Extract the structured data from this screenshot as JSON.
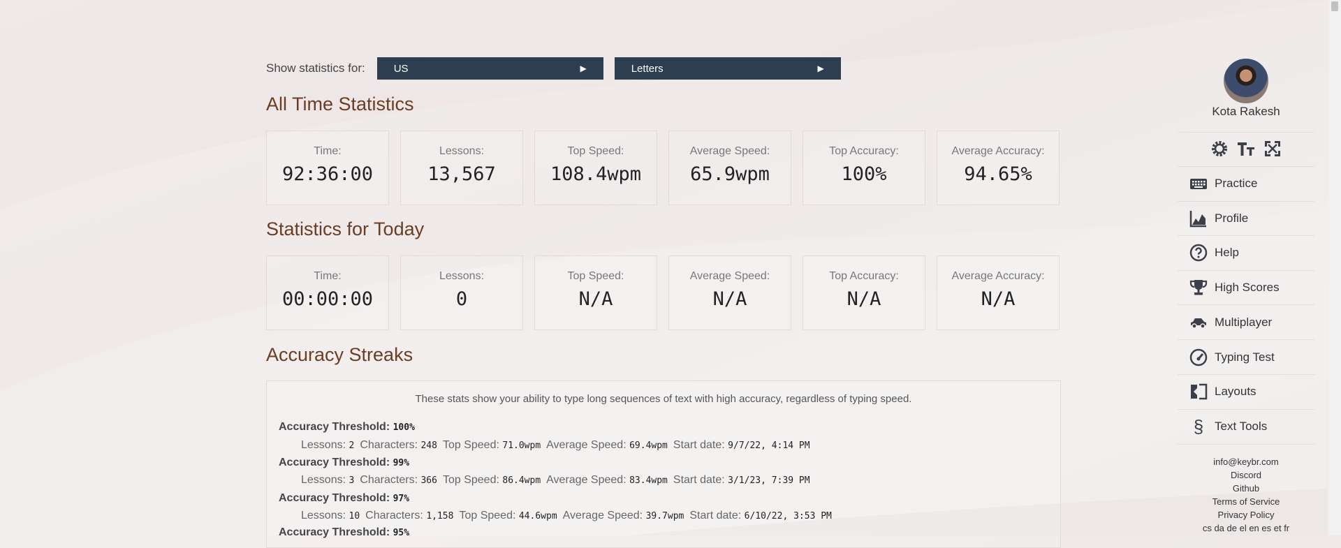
{
  "selector": {
    "label": "Show statistics for:",
    "layout_value": "US",
    "mode_value": "Letters"
  },
  "all_time": {
    "heading": "All Time Statistics",
    "cards": [
      {
        "label": "Time:",
        "value": "92:36:00"
      },
      {
        "label": "Lessons:",
        "value": "13,567"
      },
      {
        "label": "Top Speed:",
        "value": "108.4wpm"
      },
      {
        "label": "Average Speed:",
        "value": "65.9wpm"
      },
      {
        "label": "Top Accuracy:",
        "value": "100%"
      },
      {
        "label": "Average Accuracy:",
        "value": "94.65%"
      }
    ]
  },
  "today": {
    "heading": "Statistics for Today",
    "cards": [
      {
        "label": "Time:",
        "value": "00:00:00"
      },
      {
        "label": "Lessons:",
        "value": "0"
      },
      {
        "label": "Top Speed:",
        "value": "N/A"
      },
      {
        "label": "Average Speed:",
        "value": "N/A"
      },
      {
        "label": "Top Accuracy:",
        "value": "N/A"
      },
      {
        "label": "Average Accuracy:",
        "value": "N/A"
      }
    ]
  },
  "streaks": {
    "heading": "Accuracy Streaks",
    "intro": "These stats show your ability to type long sequences of text with high accuracy, regardless of typing speed.",
    "threshold_label": "Accuracy Threshold:",
    "labels": {
      "lessons": "Lessons:",
      "characters": "Characters:",
      "top_speed": "Top Speed:",
      "avg_speed": "Average Speed:",
      "start_date": "Start date:"
    },
    "rows": [
      {
        "threshold": "100%",
        "lessons": "2",
        "characters": "248",
        "top_speed": "71.0wpm",
        "avg_speed": "69.4wpm",
        "start_date": "9/7/22, 4:14 PM"
      },
      {
        "threshold": "99%",
        "lessons": "3",
        "characters": "366",
        "top_speed": "86.4wpm",
        "avg_speed": "83.4wpm",
        "start_date": "3/1/23, 7:39 PM"
      },
      {
        "threshold": "97%",
        "lessons": "10",
        "characters": "1,158",
        "top_speed": "44.6wpm",
        "avg_speed": "39.7wpm",
        "start_date": "6/10/22, 3:53 PM"
      },
      {
        "threshold": "95%"
      }
    ]
  },
  "sidebar": {
    "user_name": "Kota Rakesh",
    "nav": [
      {
        "label": "Practice",
        "icon": "keyboard-icon"
      },
      {
        "label": "Profile",
        "icon": "chart-icon"
      },
      {
        "label": "Help",
        "icon": "help-icon"
      },
      {
        "label": "High Scores",
        "icon": "trophy-icon"
      },
      {
        "label": "Multiplayer",
        "icon": "car-icon"
      },
      {
        "label": "Typing Test",
        "icon": "gauge-icon"
      },
      {
        "label": "Layouts",
        "icon": "layouts-icon"
      },
      {
        "label": "Text Tools",
        "icon": "section-icon"
      }
    ],
    "links": [
      "info@keybr.com",
      "Discord",
      "Github",
      "Terms of Service",
      "Privacy Policy",
      "cs da de el en es et fr"
    ]
  },
  "colors": {
    "heading": "#6b3d22",
    "selector_bg": "#2c3e50"
  }
}
